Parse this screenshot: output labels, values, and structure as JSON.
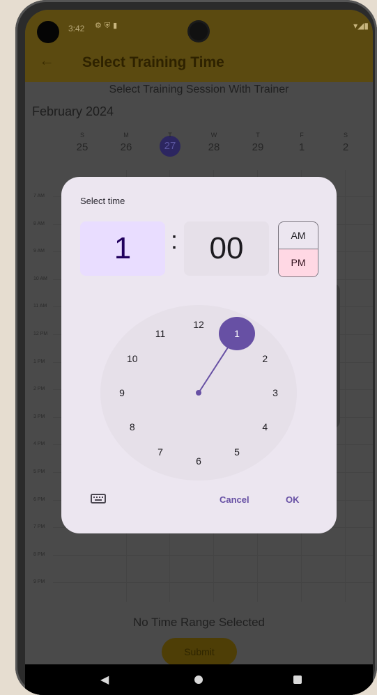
{
  "status": {
    "time": "3:42",
    "icons": [
      "settings-icon",
      "shield-icon",
      "sd-card-icon"
    ],
    "right_icons": "▾◢▮"
  },
  "appbar": {
    "title": "Select Training Time",
    "back_icon": "←"
  },
  "subtitle": "Select Training Session With Trainer",
  "month": "February 2024",
  "days": [
    {
      "w": "S",
      "n": "25"
    },
    {
      "w": "M",
      "n": "26"
    },
    {
      "w": "T",
      "n": "27",
      "selected": true
    },
    {
      "w": "W",
      "n": "28"
    },
    {
      "w": "T",
      "n": "29"
    },
    {
      "w": "F",
      "n": "1"
    },
    {
      "w": "S",
      "n": "2"
    }
  ],
  "hours": [
    "7 AM",
    "8 AM",
    "9 AM",
    "10 AM",
    "11 AM",
    "12 PM",
    "1 PM",
    "2 PM",
    "3 PM",
    "4 PM",
    "5 PM",
    "6 PM",
    "7 PM",
    "8 PM",
    "9 PM"
  ],
  "no_selection": "No Time Range Selected",
  "submit_label": "Submit",
  "dialog": {
    "title": "Select time",
    "hour": "1",
    "colon": ":",
    "minute": "00",
    "am": "AM",
    "pm": "PM",
    "period_selected": "PM",
    "clock_numbers": [
      "12",
      "1",
      "2",
      "3",
      "4",
      "5",
      "6",
      "7",
      "8",
      "9",
      "10",
      "11"
    ],
    "selected_hour": "1",
    "cancel": "Cancel",
    "ok": "OK"
  },
  "colors": {
    "accent": "#6750a4",
    "hour_bg": "#e9ddff",
    "pm_bg": "#ffd8e4",
    "dialog_bg": "#ece6f0"
  }
}
